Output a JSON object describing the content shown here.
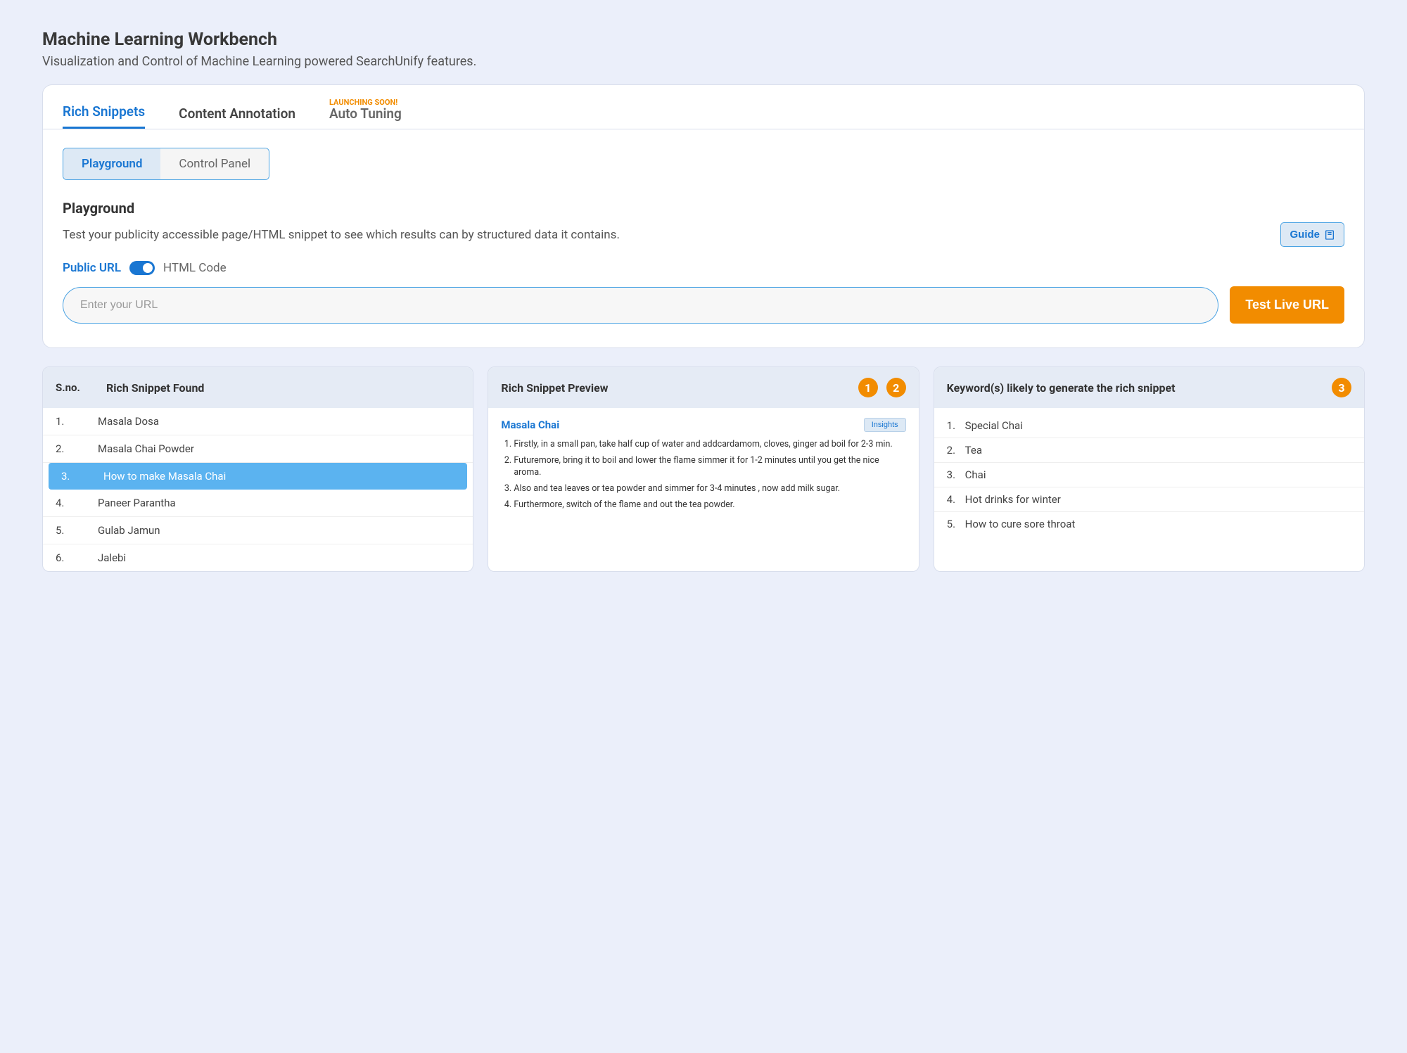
{
  "header": {
    "title": "Machine Learning Workbench",
    "subtitle": "Visualization and Control of Machine Learning powered SearchUnify features."
  },
  "tabs": {
    "rich_snippets": "Rich Snippets",
    "content_annotation": "Content Annotation",
    "auto_tuning": "Auto Tuning",
    "auto_tuning_badge": "LAUNCHING SOON!"
  },
  "subtabs": {
    "playground": "Playground",
    "control_panel": "Control Panel"
  },
  "playground": {
    "title": "Playground",
    "description": "Test your publicity accessible page/HTML snippet to see which results can by structured data it contains.",
    "guide_label": "Guide",
    "toggle_left": "Public URL",
    "toggle_right": "HTML Code",
    "url_placeholder": "Enter your URL",
    "test_button": "Test Live URL"
  },
  "results": {
    "found": {
      "col_sno": "S.no.",
      "col_title": "Rich Snippet Found",
      "rows": [
        {
          "n": "1.",
          "label": "Masala Dosa"
        },
        {
          "n": "2.",
          "label": "Masala Chai Powder"
        },
        {
          "n": "3.",
          "label": "How to make Masala Chai"
        },
        {
          "n": "4.",
          "label": "Paneer Parantha"
        },
        {
          "n": "5.",
          "label": "Gulab Jamun"
        },
        {
          "n": "6.",
          "label": "Jalebi"
        }
      ],
      "selected_index": 2
    },
    "preview": {
      "header": "Rich Snippet Preview",
      "badge1": "1",
      "badge2": "2",
      "title": "Masala Chai",
      "insights_label": "Insights",
      "steps": [
        "Firstly, in a small pan, take half cup of water and addcardamom, cloves, ginger ad boil for 2-3 min.",
        "Futuremore, bring it to boil and lower the flame simmer it for 1-2 minutes until you get the nice aroma.",
        "Also and tea leaves or tea powder and simmer for 3-4 minutes , now add milk sugar.",
        "Furthermore, switch of the flame and out the tea powder."
      ]
    },
    "keywords": {
      "header": "Keyword(s) likely to generate the rich snippet",
      "badge": "3",
      "rows": [
        {
          "n": "1.",
          "label": "Special Chai"
        },
        {
          "n": "2.",
          "label": "Tea"
        },
        {
          "n": "3.",
          "label": "Chai"
        },
        {
          "n": "4.",
          "label": "Hot drinks for winter"
        },
        {
          "n": "5.",
          "label": "How to cure sore throat"
        }
      ]
    }
  }
}
